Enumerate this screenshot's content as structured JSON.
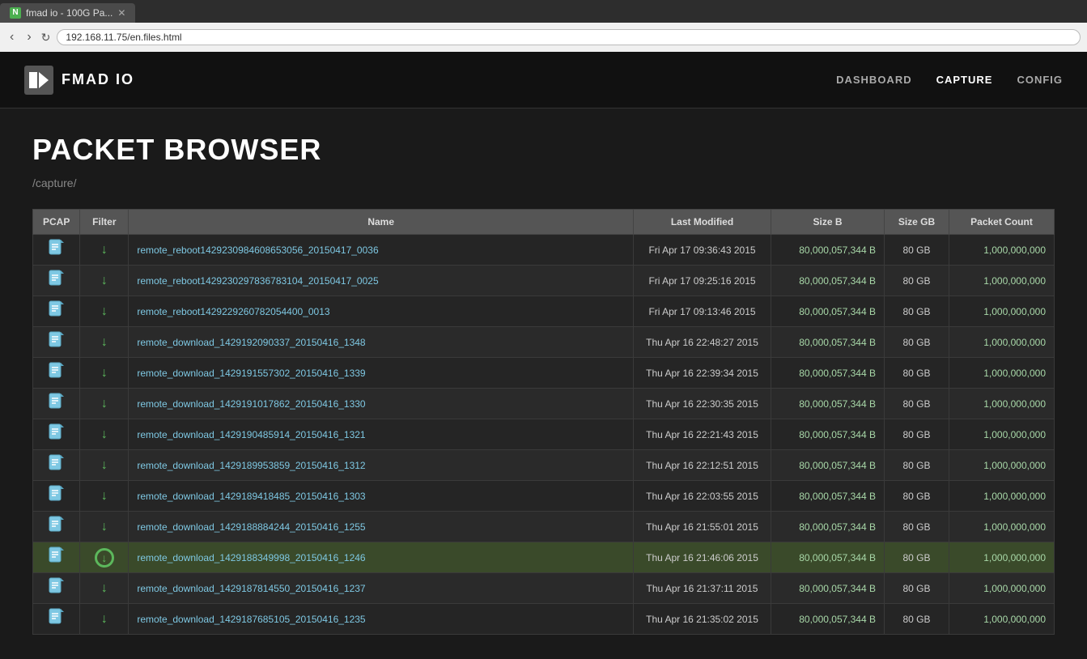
{
  "browser": {
    "tab_label": "fmad io - 100G Pa...",
    "tab_favicon": "N",
    "address": "192.168.11.75/en.files.html"
  },
  "header": {
    "logo_text": "FMAD IO",
    "nav": [
      {
        "label": "DASHBOARD",
        "active": false
      },
      {
        "label": "CAPTURE",
        "active": true
      },
      {
        "label": "CONFIG",
        "active": false
      }
    ]
  },
  "page": {
    "title": "PACKET BROWSER",
    "breadcrumb": "/capture/"
  },
  "table": {
    "columns": [
      "PCAP",
      "Filter",
      "Name",
      "Last Modified",
      "Size B",
      "Size GB",
      "Packet Count"
    ],
    "rows": [
      {
        "name": "remote_reboot1429230984608653056_20150417_0036",
        "date": "Fri Apr 17 09:36:43 2015",
        "size_b": "80,000,057,344 B",
        "size_gb": "80 GB",
        "packets": "1,000,000,000",
        "highlighted": false,
        "circle_icon": false
      },
      {
        "name": "remote_reboot1429230297836783104_20150417_0025",
        "date": "Fri Apr 17 09:25:16 2015",
        "size_b": "80,000,057,344 B",
        "size_gb": "80 GB",
        "packets": "1,000,000,000",
        "highlighted": false,
        "circle_icon": false
      },
      {
        "name": "remote_reboot1429229260782054400_0013",
        "date": "Fri Apr 17 09:13:46 2015",
        "size_b": "80,000,057,344 B",
        "size_gb": "80 GB",
        "packets": "1,000,000,000",
        "highlighted": false,
        "circle_icon": false
      },
      {
        "name": "remote_download_1429192090337_20150416_1348",
        "date": "Thu Apr 16 22:48:27 2015",
        "size_b": "80,000,057,344 B",
        "size_gb": "80 GB",
        "packets": "1,000,000,000",
        "highlighted": false,
        "circle_icon": false
      },
      {
        "name": "remote_download_1429191557302_20150416_1339",
        "date": "Thu Apr 16 22:39:34 2015",
        "size_b": "80,000,057,344 B",
        "size_gb": "80 GB",
        "packets": "1,000,000,000",
        "highlighted": false,
        "circle_icon": false
      },
      {
        "name": "remote_download_1429191017862_20150416_1330",
        "date": "Thu Apr 16 22:30:35 2015",
        "size_b": "80,000,057,344 B",
        "size_gb": "80 GB",
        "packets": "1,000,000,000",
        "highlighted": false,
        "circle_icon": false
      },
      {
        "name": "remote_download_1429190485914_20150416_1321",
        "date": "Thu Apr 16 22:21:43 2015",
        "size_b": "80,000,057,344 B",
        "size_gb": "80 GB",
        "packets": "1,000,000,000",
        "highlighted": false,
        "circle_icon": false
      },
      {
        "name": "remote_download_1429189953859_20150416_1312",
        "date": "Thu Apr 16 22:12:51 2015",
        "size_b": "80,000,057,344 B",
        "size_gb": "80 GB",
        "packets": "1,000,000,000",
        "highlighted": false,
        "circle_icon": false
      },
      {
        "name": "remote_download_1429189418485_20150416_1303",
        "date": "Thu Apr 16 22:03:55 2015",
        "size_b": "80,000,057,344 B",
        "size_gb": "80 GB",
        "packets": "1,000,000,000",
        "highlighted": false,
        "circle_icon": false
      },
      {
        "name": "remote_download_1429188884244_20150416_1255",
        "date": "Thu Apr 16 21:55:01 2015",
        "size_b": "80,000,057,344 B",
        "size_gb": "80 GB",
        "packets": "1,000,000,000",
        "highlighted": false,
        "circle_icon": false
      },
      {
        "name": "remote_download_1429188349998_20150416_1246",
        "date": "Thu Apr 16 21:46:06 2015",
        "size_b": "80,000,057,344 B",
        "size_gb": "80 GB",
        "packets": "1,000,000,000",
        "highlighted": true,
        "circle_icon": true
      },
      {
        "name": "remote_download_1429187814550_20150416_1237",
        "date": "Thu Apr 16 21:37:11 2015",
        "size_b": "80,000,057,344 B",
        "size_gb": "80 GB",
        "packets": "1,000,000,000",
        "highlighted": false,
        "circle_icon": false
      },
      {
        "name": "remote_download_1429187685105_20150416_1235",
        "date": "Thu Apr 16 21:35:02 2015",
        "size_b": "80,000,057,344 B",
        "size_gb": "80 GB",
        "packets": "1,000,000,000",
        "highlighted": false,
        "circle_icon": false
      }
    ]
  }
}
